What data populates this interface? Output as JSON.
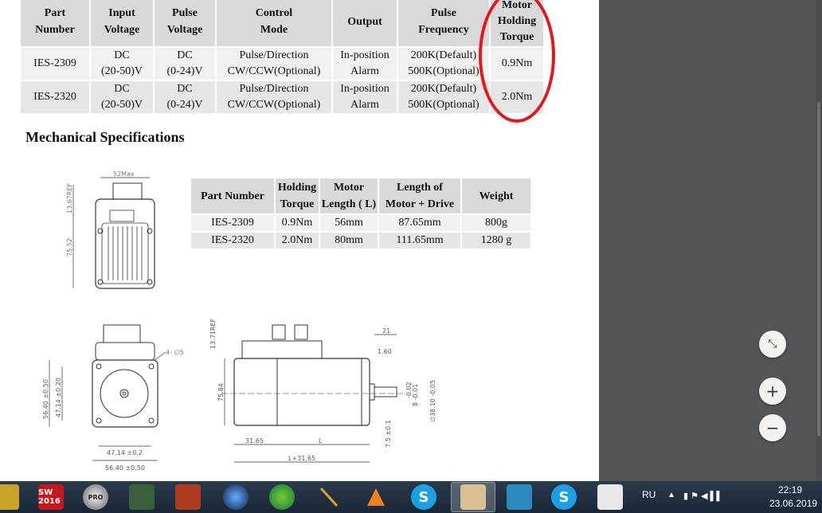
{
  "top_table": {
    "headers": [
      {
        "line1": "Part",
        "line2": "Number"
      },
      {
        "line1": "Input",
        "line2": "Voltage"
      },
      {
        "line1": "Pulse",
        "line2": "Voltage"
      },
      {
        "line1": "Control",
        "line2": "Mode"
      },
      {
        "line1": "Output",
        "line2": ""
      },
      {
        "line1": "Pulse",
        "line2": "Frequency"
      },
      {
        "line1": "Motor",
        "line2": "Holding",
        "line3": "Torque"
      }
    ],
    "rows": [
      {
        "part": "IES-2309",
        "input1": "DC",
        "input2": "(20-50)V",
        "pulse1": "DC",
        "pulse2": "(0-24)V",
        "mode1": "Pulse/Direction",
        "mode2": "CW/CCW(Optional)",
        "out1": "In-position",
        "out2": "Alarm",
        "freq1": "200K(Default)",
        "freq2": "500K(Optional)",
        "torque": "0.9Nm"
      },
      {
        "part": "IES-2320",
        "input1": "DC",
        "input2": "(20-50)V",
        "pulse1": "DC",
        "pulse2": "(0-24)V",
        "mode1": "Pulse/Direction",
        "mode2": "CW/CCW(Optional)",
        "out1": "In-position",
        "out2": "Alarm",
        "freq1": "200K(Default)",
        "freq2": "500K(Optional)",
        "torque": "2.0Nm"
      }
    ]
  },
  "section_title": "Mechanical Specifications",
  "mech_table": {
    "headers": [
      {
        "line1": "Part Number",
        "line2": ""
      },
      {
        "line1": "Holding",
        "line2": "Torque"
      },
      {
        "line1": "Motor",
        "line2": "Length ( L)"
      },
      {
        "line1": "Length of",
        "line2": "Motor + Drive"
      },
      {
        "line1": "Weight",
        "line2": ""
      }
    ],
    "rows": [
      {
        "part": "IES-2309",
        "torque": "0.9Nm",
        "length": "56mm",
        "total": "87.65mm",
        "weight": "800g"
      },
      {
        "part": "IES-2320",
        "torque": "2.0Nm",
        "length": "80mm",
        "total": "111.65mm",
        "weight": "1280 g"
      }
    ]
  },
  "drawings": {
    "top": {
      "width": "52Max",
      "height": "75.52",
      "ref": "13.67REF"
    },
    "front": {
      "holes": "4- ∅5",
      "h1": "56.40 ±0.50",
      "h2": "47.14 ±0.20",
      "w1": "47.14 ±0.2",
      "w2": "56.40 ±0.50"
    },
    "side": {
      "ref": "13.71REF",
      "height": "75.84",
      "d21": "21",
      "d160": "1.60",
      "shaft": "8 -0.01",
      "shaft2": "-0.02",
      "flange": "∅38.10 -0.05",
      "d31": "31.65",
      "len": "L",
      "total": "L+31.65",
      "d75": "7.5 ±0.1"
    }
  },
  "zoom_buttons": {
    "fit": "⤡",
    "plus": "+",
    "minus": "−"
  },
  "taskbar": {
    "apps": [
      "SW 2016",
      "PRO",
      "",
      "",
      "",
      "",
      "",
      "",
      "S",
      "",
      "",
      "S",
      ""
    ],
    "language": "RU",
    "time": "22:19",
    "date": "23.06.2019"
  },
  "colors": {
    "annotation": "#e8141b",
    "header_bg": "#d9d9d9",
    "taskbar": "#1f2d3f"
  }
}
